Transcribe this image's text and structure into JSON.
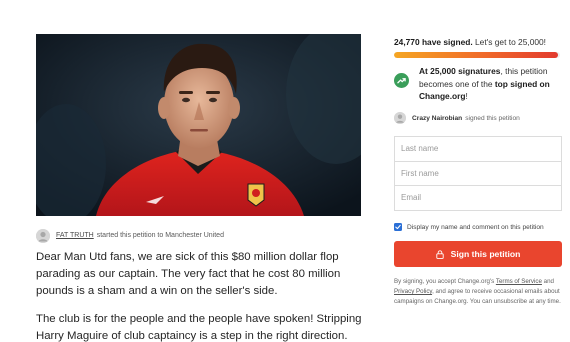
{
  "hero": {
    "image": "photo-of-footballer-in-red-manchester-united-kit"
  },
  "starter": {
    "author": "FAT TRUTH",
    "action": "started this petition to Manchester United"
  },
  "body": {
    "paragraphs": [
      "Dear Man Utd fans, we are sick of this $80 million dollar flop parading as our captain. The very fact that he cost 80 million pounds is a sham and a win on the seller's side.",
      "The club is for the people and the people have spoken! Stripping Harry Maguire of club captaincy is a step in the right direction."
    ]
  },
  "signatures": {
    "count_text": "24,770 have signed.",
    "goal_text": "Let's get to 25,000!",
    "progress_fraction": 0.99
  },
  "milestone": {
    "lead": "At 25,000 signatures",
    "middle": ", this petition becomes one of the ",
    "emph": "top signed on Change.org",
    "tail": "!"
  },
  "recent_signer": {
    "name": "Crazy Nairobian",
    "action": "signed this petition"
  },
  "form": {
    "first_name_placeholder": "Last name",
    "last_name_placeholder": "First name",
    "email_placeholder": "Email"
  },
  "display_option": {
    "label": "Display my name and comment on this petition",
    "checked": true
  },
  "sign_button": {
    "label": "Sign this petition"
  },
  "legal": {
    "prefix": "By signing, you accept Change.org's ",
    "terms": "Terms of Service",
    "and": " and ",
    "privacy": "Privacy Policy",
    "suffix": ", and agree to receive occasional emails about campaigns on Change.org. You can unsubscribe at any time."
  },
  "colors": {
    "accent": "#e9452e",
    "badge_green": "#3a9e5a",
    "checkbox_blue": "#2a6fd6"
  }
}
